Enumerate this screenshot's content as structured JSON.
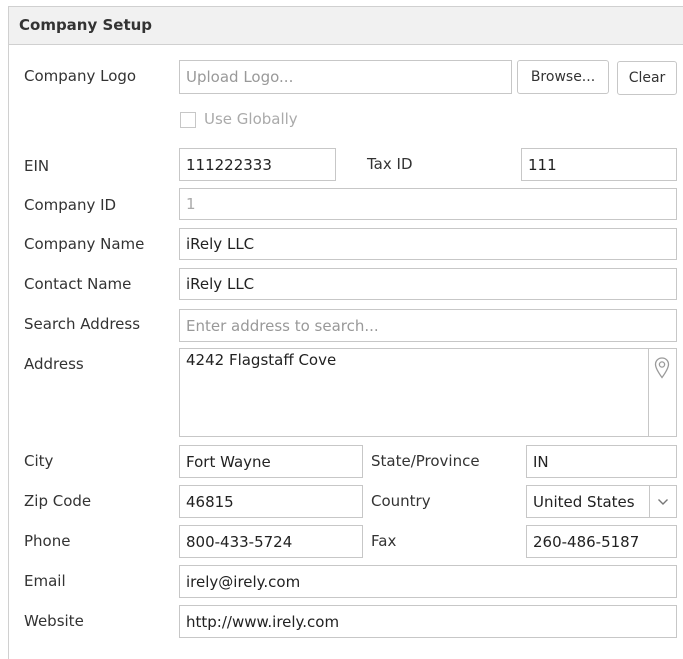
{
  "panel": {
    "title": "Company Setup"
  },
  "labels": {
    "company_logo": "Company Logo",
    "ein": "EIN",
    "tax_id": "Tax ID",
    "company_id": "Company ID",
    "company_name": "Company Name",
    "contact_name": "Contact Name",
    "search_address": "Search Address",
    "address": "Address",
    "city": "City",
    "state": "State/Province",
    "zip": "Zip Code",
    "country": "Country",
    "phone": "Phone",
    "fax": "Fax",
    "email": "Email",
    "website": "Website"
  },
  "logo": {
    "placeholder": "Upload Logo...",
    "browse_label": "Browse...",
    "clear_label": "Clear",
    "use_globally_label": "Use Globally",
    "use_globally_checked": false
  },
  "fields": {
    "ein": "111222333",
    "tax_id": "111",
    "company_id": "1",
    "company_name": "iRely LLC",
    "contact_name": "iRely LLC",
    "search_address_placeholder": "Enter address to search...",
    "address": "4242 Flagstaff Cove",
    "city": "Fort Wayne",
    "state": "IN",
    "zip": "46815",
    "country": "United States",
    "phone": "800-433-5724",
    "fax": "260-486-5187",
    "email": "irely@irely.com",
    "website": "http://www.irely.com"
  },
  "icons": {
    "address_pin": "map-pin-icon",
    "country_dropdown": "chevron-down-icon"
  },
  "colors": {
    "header_bg": "#f1f1f1",
    "border": "#c7c7c7",
    "placeholder": "#999999"
  }
}
